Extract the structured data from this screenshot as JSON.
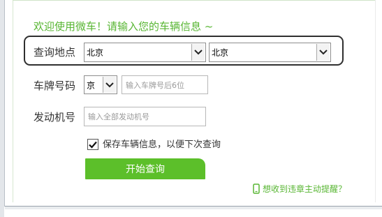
{
  "greeting": "欢迎使用微车！请输入您的车辆信息 ~",
  "location": {
    "label": "查询地点",
    "province": "北京",
    "city": "北京"
  },
  "plate": {
    "label": "车牌号码",
    "prefix": "京",
    "placeholder": "输入车牌号后6位"
  },
  "engine": {
    "label": "发动机号",
    "placeholder": "输入全部发动机号"
  },
  "save_info": {
    "label": "保存车辆信息，以便下次查询",
    "checked": true
  },
  "search_button": "开始查询",
  "reminder_link": "想收到违章主动提醒？",
  "colors": {
    "accent": "#5cbf2a",
    "accent_text": "#58b633"
  }
}
